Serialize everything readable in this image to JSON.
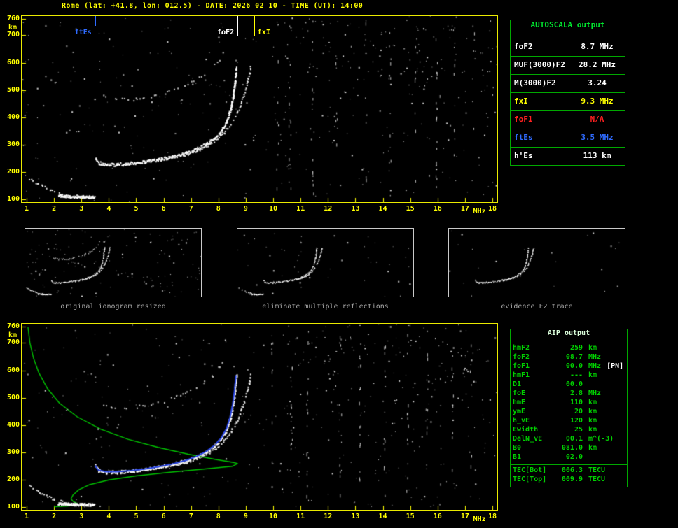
{
  "title": "Rome (lat: +41.8, lon: 012.5) - DATE: 2026 02 10 - TIME (UT): 14:00",
  "colors": {
    "axis": "#ffff00",
    "echo_trace": "#ffffff",
    "profile": "#00c400",
    "fit": "#2643e6",
    "table_border": "#00a800",
    "ftEs_blue": "#2f6bff",
    "fxI_yellow": "#ffff00",
    "foF1_red": "#ff2020"
  },
  "autoscala_table": {
    "title": "AUTOSCALA output",
    "rows": [
      {
        "label": "foF2",
        "value": "8.7 MHz",
        "color": "#ffffff"
      },
      {
        "label": "MUF(3000)F2",
        "value": "28.2 MHz",
        "color": "#ffffff"
      },
      {
        "label": "M(3000)F2",
        "value": "3.24",
        "color": "#ffffff"
      },
      {
        "label": "fxI",
        "value": "9.3 MHz",
        "color": "#ffff00"
      },
      {
        "label": "foF1",
        "value": "N/A",
        "color": "#ff2020"
      },
      {
        "label": "ftEs",
        "value": "3.5 MHz",
        "color": "#2f6bff"
      },
      {
        "label": "h'Es",
        "value": "113   km",
        "color": "#ffffff"
      }
    ]
  },
  "aip_table": {
    "title": "AIP output",
    "rows": [
      {
        "label": "hmF2",
        "value": "259",
        "unit": "km",
        "note": ""
      },
      {
        "label": "foF2",
        "value": "08.7",
        "unit": "MHz",
        "note": ""
      },
      {
        "label": "foF1",
        "value": "00.0",
        "unit": "MHz",
        "note": "[PN]"
      },
      {
        "label": "hmF1",
        "value": "---",
        "unit": "km",
        "note": ""
      },
      {
        "label": "D1",
        "value": "00.0",
        "unit": "",
        "note": ""
      },
      {
        "label": "foE",
        "value": "2.8",
        "unit": "MHz",
        "note": ""
      },
      {
        "label": "hmE",
        "value": "110",
        "unit": "km",
        "note": ""
      },
      {
        "label": "ymE",
        "value": "20",
        "unit": "km",
        "note": ""
      },
      {
        "label": "h_vE",
        "value": "120",
        "unit": "km",
        "note": ""
      },
      {
        "label": "Ewidth",
        "value": "25",
        "unit": "km",
        "note": ""
      },
      {
        "label": "DelN_vE",
        "value": "00.1",
        "unit": "m^(-3)",
        "note": ""
      },
      {
        "label": "B0",
        "value": "081.0",
        "unit": "km",
        "note": ""
      },
      {
        "label": "B1",
        "value": "02.0",
        "unit": "",
        "note": ""
      }
    ],
    "tec_rows": [
      {
        "label": "TEC[Bot]",
        "value": "006.3",
        "unit": "TECU"
      },
      {
        "label": "TEC[Top]",
        "value": "009.9",
        "unit": "TECU"
      }
    ]
  },
  "thumbnails": [
    {
      "caption": "original ionogram resized",
      "trace_ids": [
        "es_low",
        "es_dense",
        "f2_ordinary",
        "f2_extraordinary",
        "second_hop"
      ]
    },
    {
      "caption": "eliminate multiple reflections",
      "trace_ids": [
        "es_low",
        "es_dense",
        "f2_ordinary",
        "f2_extraordinary"
      ]
    },
    {
      "caption": "evidence F2 trace",
      "trace_ids": [
        "f2_ordinary",
        "f2_extraordinary"
      ]
    }
  ],
  "chart_data": {
    "type": "scatter",
    "description": "Ionogram echoes: virtual height (km) vs sounding frequency (MHz)",
    "charts": [
      {
        "id": "scaled_ionogram",
        "xlabel": "MHz",
        "ylabel": "km",
        "xlim": [
          1,
          18
        ],
        "ylim": [
          100,
          760
        ],
        "xticks": [
          1,
          2,
          3,
          4,
          5,
          6,
          7,
          8,
          9,
          10,
          11,
          12,
          13,
          14,
          15,
          16,
          17,
          18
        ],
        "yticks": [
          100,
          200,
          300,
          400,
          500,
          600,
          700,
          760
        ],
        "markers": [
          {
            "label": "ftEs",
            "freq": 3.5,
            "color": "#2f6bff",
            "label_side": "left",
            "tick_len": 14
          },
          {
            "label": "foF2",
            "freq": 8.7,
            "color": "#ffffff",
            "label_side": "left",
            "tick_len": 28
          },
          {
            "label": "fxI",
            "freq": 9.3,
            "color": "#ffff00",
            "label_side": "right",
            "tick_len": 28
          }
        ],
        "trace_ids": [
          "es_low",
          "es_dense",
          "f2_ordinary",
          "f2_extraordinary",
          "second_hop"
        ],
        "rfi_freqs": [
          10.15,
          10.6,
          11.45,
          12.3,
          13.35,
          14.25,
          15.2,
          15.95,
          16.6,
          17.3
        ]
      },
      {
        "id": "restored_ionogram_with_profile",
        "xlabel": "MHz",
        "ylabel": "km",
        "xlim": [
          1,
          18
        ],
        "ylim": [
          100,
          760
        ],
        "xticks": [
          1,
          2,
          3,
          4,
          5,
          6,
          7,
          8,
          9,
          10,
          11,
          12,
          13,
          14,
          15,
          16,
          17,
          18
        ],
        "yticks": [
          100,
          200,
          300,
          400,
          500,
          600,
          700,
          760
        ],
        "markers": [],
        "trace_ids": [
          "es_low",
          "es_dense",
          "f2_ordinary",
          "f2_extraordinary",
          "second_hop"
        ],
        "profile_trace": "electron_density_profile",
        "fit_trace": "f2_fit",
        "rfi_freqs": [
          9.95,
          10.65,
          11.25,
          12.45,
          13.15,
          14.05,
          14.9,
          15.6,
          16.1,
          16.55,
          17.2
        ]
      }
    ],
    "traces": {
      "es_low": [
        [
          1.1,
          178
        ],
        [
          1.4,
          158
        ],
        [
          1.7,
          143
        ],
        [
          2.0,
          130
        ],
        [
          2.3,
          121
        ],
        [
          2.6,
          115
        ],
        [
          3.0,
          112
        ],
        [
          3.45,
          110
        ]
      ],
      "es_dense": [
        [
          2.15,
          114
        ],
        [
          2.8,
          111
        ],
        [
          3.45,
          110
        ]
      ],
      "f2_ordinary": [
        [
          3.5,
          252
        ],
        [
          3.62,
          235
        ],
        [
          3.9,
          229
        ],
        [
          4.3,
          229
        ],
        [
          4.8,
          233
        ],
        [
          5.3,
          239
        ],
        [
          5.8,
          247
        ],
        [
          6.3,
          257
        ],
        [
          6.8,
          270
        ],
        [
          7.2,
          285
        ],
        [
          7.55,
          303
        ],
        [
          7.85,
          325
        ],
        [
          8.1,
          352
        ],
        [
          8.3,
          388
        ],
        [
          8.43,
          430
        ],
        [
          8.52,
          475
        ],
        [
          8.58,
          520
        ],
        [
          8.62,
          560
        ],
        [
          8.64,
          582
        ]
      ],
      "f2_extraordinary": [
        [
          6.2,
          252
        ],
        [
          6.7,
          263
        ],
        [
          7.15,
          277
        ],
        [
          7.55,
          295
        ],
        [
          7.9,
          318
        ],
        [
          8.2,
          345
        ],
        [
          8.45,
          378
        ],
        [
          8.65,
          415
        ],
        [
          8.82,
          455
        ],
        [
          8.95,
          495
        ],
        [
          9.05,
          532
        ],
        [
          9.12,
          562
        ],
        [
          9.16,
          584
        ]
      ],
      "second_hop": [
        [
          3.7,
          478
        ],
        [
          4.2,
          468
        ],
        [
          4.7,
          466
        ],
        [
          5.2,
          470
        ],
        [
          5.7,
          480
        ],
        [
          6.2,
          494
        ],
        [
          6.7,
          512
        ],
        [
          7.1,
          532
        ],
        [
          7.45,
          556
        ],
        [
          7.75,
          584
        ],
        [
          8.0,
          615
        ],
        [
          8.15,
          645
        ]
      ],
      "f2_fit": [
        [
          3.5,
          252
        ],
        [
          3.62,
          235
        ],
        [
          3.9,
          229
        ],
        [
          4.3,
          229
        ],
        [
          4.8,
          233
        ],
        [
          5.3,
          239
        ],
        [
          5.8,
          247
        ],
        [
          6.3,
          257
        ],
        [
          6.8,
          270
        ],
        [
          7.2,
          285
        ],
        [
          7.55,
          303
        ],
        [
          7.85,
          325
        ],
        [
          8.1,
          352
        ],
        [
          8.3,
          388
        ],
        [
          8.43,
          430
        ],
        [
          8.52,
          475
        ],
        [
          8.58,
          520
        ],
        [
          8.62,
          560
        ],
        [
          8.64,
          582
        ]
      ],
      "electron_density_profile": [
        [
          1.05,
          758
        ],
        [
          1.12,
          700
        ],
        [
          1.25,
          645
        ],
        [
          1.45,
          590
        ],
        [
          1.75,
          535
        ],
        [
          2.2,
          480
        ],
        [
          2.85,
          430
        ],
        [
          3.7,
          385
        ],
        [
          4.7,
          348
        ],
        [
          5.8,
          318
        ],
        [
          6.9,
          293
        ],
        [
          7.9,
          274
        ],
        [
          8.55,
          263
        ],
        [
          8.7,
          259
        ],
        [
          8.5,
          249
        ],
        [
          7.6,
          240
        ],
        [
          6.3,
          228
        ],
        [
          5.0,
          214
        ],
        [
          4.0,
          199
        ],
        [
          3.3,
          182
        ],
        [
          2.9,
          163
        ],
        [
          2.7,
          145
        ],
        [
          2.62,
          130
        ],
        [
          2.7,
          120
        ],
        [
          2.85,
          113
        ],
        [
          2.8,
          107
        ],
        [
          2.45,
          103
        ],
        [
          2.0,
          101
        ]
      ]
    }
  }
}
